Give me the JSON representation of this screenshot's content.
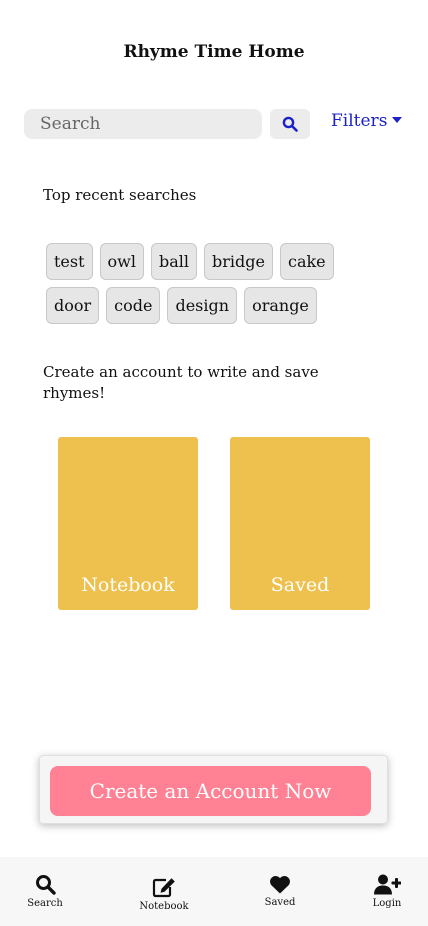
{
  "header": {
    "title": "Rhyme Time Home"
  },
  "search": {
    "placeholder": "Search",
    "value": "",
    "filters_label": "Filters"
  },
  "recent": {
    "heading": "Top recent searches",
    "chips": [
      "test",
      "owl",
      "ball",
      "bridge",
      "cake",
      "door",
      "code",
      "design",
      "orange"
    ]
  },
  "account_prompt": "Create an account to write and save rhymes!",
  "cards": {
    "notebook": "Notebook",
    "saved": "Saved"
  },
  "cta": {
    "label": "Create an Account Now"
  },
  "nav": {
    "search": "Search",
    "notebook": "Notebook",
    "saved": "Saved",
    "login": "Login"
  },
  "colors": {
    "card": "#eec04d",
    "cta": "#ff8193",
    "link": "#1b22c9"
  },
  "icons": [
    "search-icon",
    "caret-down-icon",
    "edit-icon",
    "heart-icon",
    "user-plus-icon"
  ]
}
